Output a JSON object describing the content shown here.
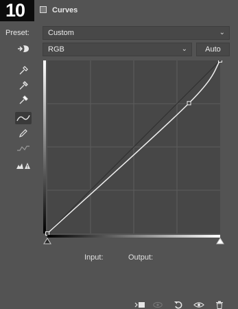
{
  "step_badge": "10",
  "header": {
    "title": "Curves",
    "icon": "curves-layer-icon"
  },
  "preset": {
    "label": "Preset:",
    "value": "Custom"
  },
  "channel": {
    "value": "RGB"
  },
  "auto_label": "Auto",
  "tools": [
    "target-adjust-icon",
    "eyedropper-black-icon",
    "eyedropper-gray-icon",
    "eyedropper-white-icon",
    "curve-points-icon",
    "pencil-icon",
    "smooth-icon",
    "clipping-warning-icon"
  ],
  "active_tool": "curve-points-icon",
  "readout": {
    "input_label": "Input:",
    "output_label": "Output:"
  },
  "curve": {
    "points": [
      [
        0,
        0
      ],
      [
        209,
        192
      ],
      [
        255,
        255
      ]
    ],
    "range": [
      0,
      255
    ]
  },
  "footer_icons": [
    "clip-to-layer-icon",
    "view-previous-icon",
    "reset-icon",
    "visibility-icon",
    "delete-icon"
  ],
  "colors": {
    "panel_bg": "#535353",
    "graph_bg": "#474747",
    "grid": "#5c5c5c",
    "curve": "#f0f0f0",
    "badge_bg": "#0c0c0c"
  }
}
